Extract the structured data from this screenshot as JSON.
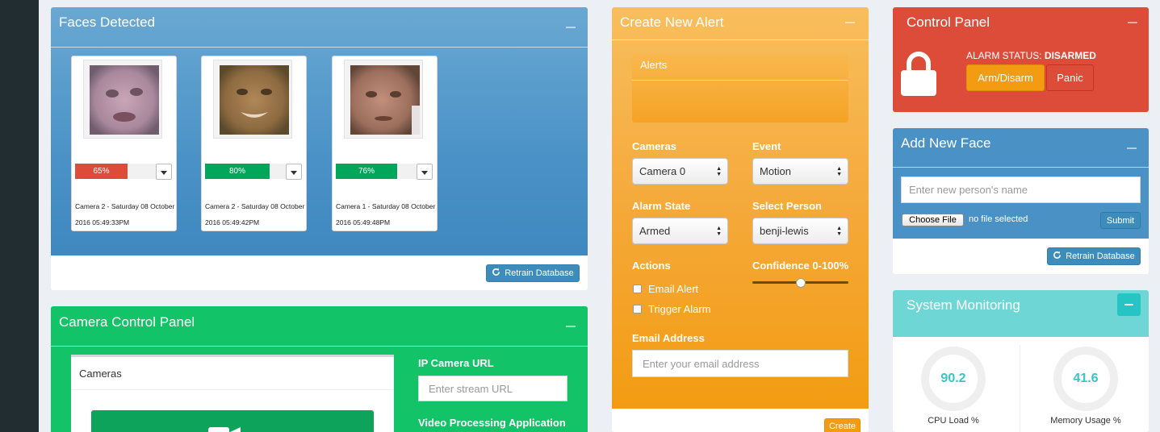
{
  "faces_panel": {
    "title": "Faces Detected",
    "faces": [
      {
        "confidence_label": "65%",
        "confidence": 0.65,
        "bar_color": "#dd4b39",
        "caption": "Camera 2 - Saturday 08 October 2016 05:49:33PM"
      },
      {
        "confidence_label": "80%",
        "confidence": 0.8,
        "bar_color": "#00a65a",
        "caption": "Camera 2 - Saturday 08 October 2016 05:49:42PM"
      },
      {
        "confidence_label": "76%",
        "confidence": 0.76,
        "bar_color": "#00a65a",
        "caption": "Camera 1 - Saturday 08 October 2016 05:49:48PM"
      }
    ],
    "retrain_label": "Retrain Database"
  },
  "camera_panel": {
    "title": "Camera Control Panel",
    "cameras_header": "Cameras",
    "ip_url_label": "IP Camera URL",
    "ip_url_placeholder": "Enter stream URL",
    "video_processing_label": "Video Processing Application"
  },
  "alert_panel": {
    "title": "Create New Alert",
    "alerts_header": "Alerts",
    "cameras_label": "Cameras",
    "camera_value": "Camera 0",
    "event_label": "Event",
    "event_value": "Motion",
    "alarm_state_label": "Alarm State",
    "alarm_state_value": "Armed",
    "select_person_label": "Select Person",
    "person_value": "benji-lewis",
    "actions_label": "Actions",
    "email_alert_label": "Email Alert",
    "trigger_alarm_label": "Trigger Alarm",
    "confidence_label": "Confidence 0-100%",
    "confidence_value": 50,
    "email_address_label": "Email Address",
    "email_placeholder": "Enter your email address",
    "create_label": "Create"
  },
  "control_panel": {
    "title": "Control Panel",
    "alarm_status_prefix": "ALARM STATUS:",
    "alarm_status_value": "DISARMED",
    "arm_label": "Arm/Disarm",
    "panic_label": "Panic"
  },
  "add_face": {
    "title": "Add New Face",
    "name_placeholder": "Enter new person's name",
    "choose_file_label": "Choose File",
    "file_status": "no file selected",
    "submit_label": "Submit",
    "retrain_label": "Retrain Database"
  },
  "system_monitoring": {
    "title": "System Monitoring",
    "cpu_value": "90.2",
    "cpu_label": "CPU Load %",
    "memory_value": "41.6",
    "memory_label": "Memory Usage %",
    "accent_color": "#39c5c5"
  }
}
